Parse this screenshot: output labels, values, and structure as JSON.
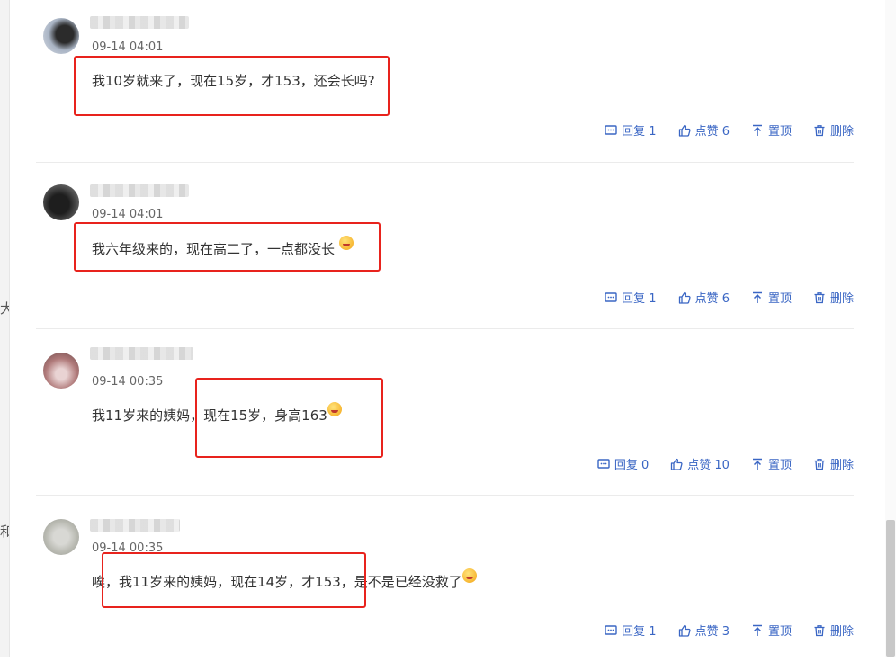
{
  "left_fragments": [
    "大",
    "和"
  ],
  "comments": [
    {
      "time": "09-14 04:01",
      "text_parts": [
        "我10岁就来了，现在15岁，才153，还会长吗?"
      ],
      "emoji": "",
      "actions": {
        "reply": "回复 1",
        "like": "点赞 6",
        "pin": "置顶",
        "delete": "删除"
      }
    },
    {
      "time": "09-14 04:01",
      "text_parts": [
        "我六年级来的，现在高二了，一点都没长"
      ],
      "emoji": "laughing-tongue-emoji",
      "actions": {
        "reply": "回复 1",
        "like": "点赞 6",
        "pin": "置顶",
        "delete": "删除"
      }
    },
    {
      "time": "09-14 00:35",
      "text_parts": [
        "我11岁来的姨妈，现在15岁，身高163"
      ],
      "emoji": "grinning-tongue-emoji",
      "actions": {
        "reply": "回复 0",
        "like": "点赞 10",
        "pin": "置顶",
        "delete": "删除"
      }
    },
    {
      "time": "09-14 00:35",
      "text_parts": [
        "唉，我11岁来的姨妈，现在14岁，才153，是不是已经没救了"
      ],
      "emoji": "crying-emoji",
      "actions": {
        "reply": "回复 1",
        "like": "点赞 3",
        "pin": "置顶",
        "delete": "删除"
      }
    }
  ],
  "colors": {
    "accent": "#3a66c4",
    "highlight_box": "#e8231d",
    "divider": "#ebebeb"
  }
}
